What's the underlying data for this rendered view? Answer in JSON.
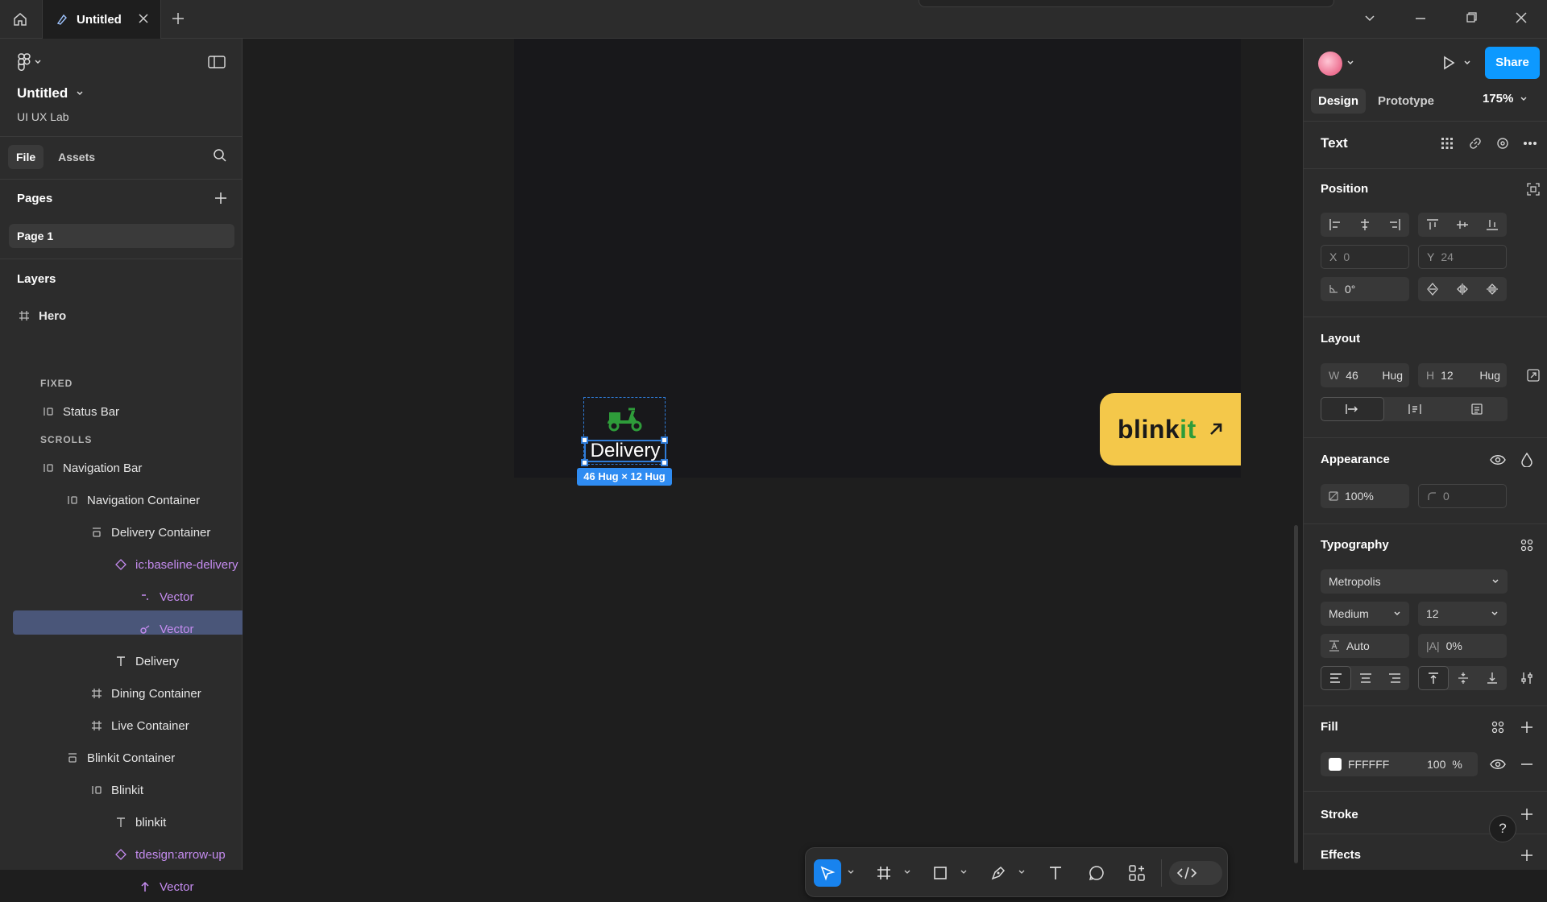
{
  "titlebar": {
    "tab_title": "Untitled",
    "icons": [
      "home-icon",
      "figma-file-icon",
      "close-icon",
      "plus-icon",
      "chevron-down-icon",
      "minimize-icon",
      "restore-icon",
      "window-close-icon"
    ]
  },
  "left": {
    "file_name": "Untitled",
    "team": "UI UX Lab",
    "tabs": [
      "File",
      "Assets"
    ],
    "pages_heading": "Pages",
    "pages": [
      "Page 1"
    ],
    "layers_heading": "Layers",
    "layers": [
      {
        "name": "Hero",
        "icon": "frame-icon"
      },
      {
        "name": "FIXED",
        "type": "section"
      },
      {
        "name": "Status Bar",
        "icon": "autolayout-icon"
      },
      {
        "name": "SCROLLS",
        "type": "section"
      },
      {
        "name": "Navigation Bar",
        "icon": "autolayout-icon"
      },
      {
        "name": "Navigation Container",
        "icon": "autolayout-icon"
      },
      {
        "name": "Delivery Container",
        "icon": "autolayout-vertical-icon"
      },
      {
        "name": "ic:baseline-delivery",
        "icon": "component-instance-icon"
      },
      {
        "name": "Vector",
        "icon": "vector-icon"
      },
      {
        "name": "Vector",
        "icon": "vector-icon"
      },
      {
        "name": "Delivery",
        "icon": "text-icon"
      },
      {
        "name": "Dining Container",
        "icon": "frame-icon"
      },
      {
        "name": "Live Container",
        "icon": "frame-icon"
      },
      {
        "name": "Blinkit Container",
        "icon": "autolayout-vertical-icon"
      },
      {
        "name": "Blinkit",
        "icon": "autolayout-icon"
      },
      {
        "name": "blinkit",
        "icon": "text-icon"
      },
      {
        "name": "tdesign:arrow-up",
        "icon": "component-instance-icon"
      },
      {
        "name": "Vector",
        "icon": "arrow-up-icon"
      }
    ]
  },
  "canvas": {
    "delivery_label": "Delivery",
    "dimension_badge": "46 Hug × 12 Hug",
    "blinkit_word_a": "blink",
    "blinkit_word_b": "it",
    "arrow_glyph": "↗",
    "colors": {
      "selection": "#2f7bd6",
      "scooter": "#2e9c3a",
      "blinkit_bg": "#f4c84a",
      "blinkit_green": "#2e9c3a"
    }
  },
  "toolbar": {
    "tools": [
      "move-tool-icon",
      "frame-tool-icon",
      "rectangle-tool-icon",
      "pen-tool-icon",
      "text-tool-icon",
      "comment-tool-icon",
      "actions-icon",
      "dev-mode-icon"
    ]
  },
  "right": {
    "share_label": "Share",
    "tabs": [
      "Design",
      "Prototype"
    ],
    "zoom": "175%",
    "layer_type": "Text",
    "position": {
      "heading": "Position",
      "x_label": "X",
      "x": "0",
      "y_label": "Y",
      "y": "24",
      "rotation": "0°"
    },
    "layout": {
      "heading": "Layout",
      "w_label": "W",
      "w": "46",
      "w_mode": "Hug",
      "h_label": "H",
      "h": "12",
      "h_mode": "Hug"
    },
    "appearance": {
      "heading": "Appearance",
      "opacity": "100%",
      "radius": "0"
    },
    "typography": {
      "heading": "Typography",
      "font": "Metropolis",
      "weight": "Medium",
      "size": "12",
      "line_height": "Auto",
      "letter_spacing_label": "|A|",
      "letter_spacing": "0%"
    },
    "fill": {
      "heading": "Fill",
      "hex": "FFFFFF",
      "opacity": "100",
      "unit": "%"
    },
    "stroke_heading": "Stroke",
    "effects_heading": "Effects",
    "help": "?",
    "colors": {
      "share": "#0d99ff"
    }
  }
}
